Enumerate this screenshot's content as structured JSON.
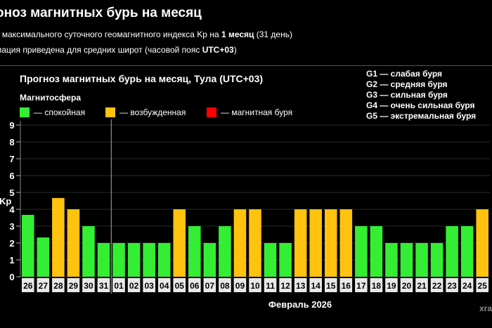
{
  "header": {
    "title": "оноз магнитных бурь на месяц",
    "line1_prefix": "з максимального суточного геомагнитного индекса Kp на ",
    "line1_bold": "1 месяц",
    "line1_suffix": " (31 день)",
    "line2_prefix": "мация приведена для средних широт (часовой пояс ",
    "line2_bold": "UTC+03",
    "line2_suffix": ")"
  },
  "legend": {
    "section": "Магнитосфера",
    "items": [
      {
        "label": "— спокойная",
        "color": "#33ee33"
      },
      {
        "label": "— возбужденная",
        "color": "#ffc20e"
      },
      {
        "label": "— магнитная буря",
        "color": "#ff0000"
      }
    ],
    "g_scale": [
      "G1 — слабая буря",
      "G2 — средняя буря",
      "G3 — сильная буря",
      "G4 — очень сильная буря",
      "G5 — экстремальная буря"
    ]
  },
  "watermark": "xra",
  "chart_data": {
    "type": "bar",
    "title": "Прогноз магнитных бурь на месяц, Тула (UTC+03)",
    "ylabel": "Kp",
    "xlabel": "Февраль 2026",
    "ylim": [
      0,
      9
    ],
    "yticks": [
      0,
      1,
      2,
      3,
      4,
      5,
      6,
      7,
      8,
      9
    ],
    "categories": [
      "26",
      "27",
      "28",
      "29",
      "30",
      "31",
      "01",
      "02",
      "03",
      "04",
      "05",
      "06",
      "07",
      "08",
      "09",
      "10",
      "11",
      "12",
      "13",
      "14",
      "15",
      "16",
      "17",
      "18",
      "19",
      "20",
      "21",
      "22",
      "23",
      "24",
      "25"
    ],
    "values": [
      3.67,
      2.33,
      4.67,
      4,
      3,
      2,
      2,
      2,
      2,
      2,
      4,
      3,
      2,
      3,
      4,
      4,
      2,
      2,
      4,
      4,
      4,
      4,
      3,
      3,
      2,
      2,
      2,
      2,
      3,
      3,
      4
    ],
    "colors": [
      "#33ee33",
      "#33ee33",
      "#ffc20e",
      "#ffc20e",
      "#33ee33",
      "#33ee33",
      "#33ee33",
      "#33ee33",
      "#33ee33",
      "#33ee33",
      "#ffc20e",
      "#33ee33",
      "#33ee33",
      "#33ee33",
      "#ffc20e",
      "#ffc20e",
      "#33ee33",
      "#33ee33",
      "#ffc20e",
      "#ffc20e",
      "#ffc20e",
      "#ffc20e",
      "#33ee33",
      "#33ee33",
      "#33ee33",
      "#33ee33",
      "#33ee33",
      "#33ee33",
      "#33ee33",
      "#33ee33",
      "#ffc20e"
    ],
    "grid": true,
    "month_divider_after": "31"
  }
}
